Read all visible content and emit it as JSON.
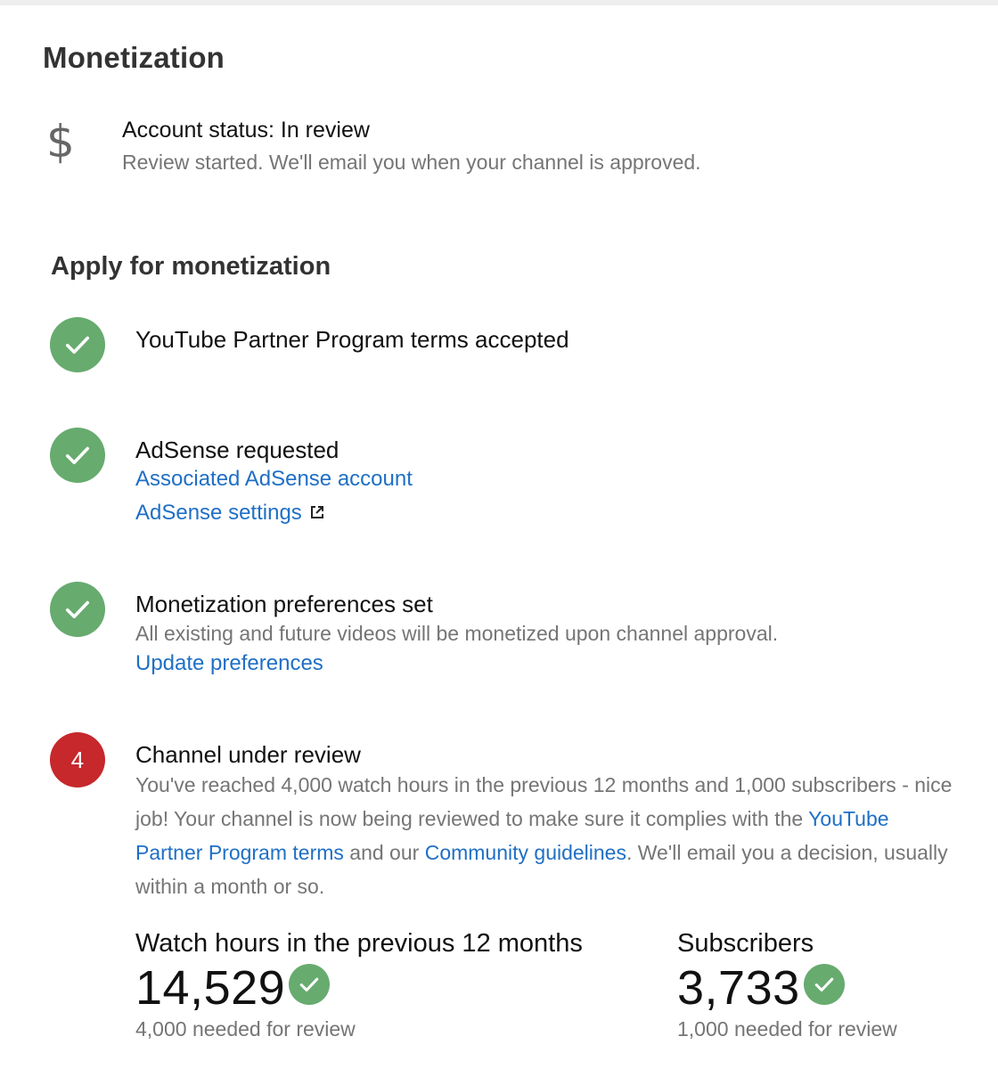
{
  "page_title": "Monetization",
  "account_status": {
    "icon": "dollar-icon",
    "symbol": "$",
    "title": "Account status: In review",
    "subtitle": "Review started. We'll email you when your channel is approved."
  },
  "apply_section": {
    "title": "Apply for monetization",
    "steps": [
      {
        "state": "done",
        "title": "YouTube Partner Program terms accepted"
      },
      {
        "state": "done",
        "title": "AdSense requested",
        "links": [
          "Associated AdSense account",
          "AdSense settings"
        ]
      },
      {
        "state": "done",
        "title": "Monetization preferences set",
        "description": "All existing and future videos will be monetized upon channel approval.",
        "link": "Update preferences"
      },
      {
        "state": "current",
        "number": "4",
        "title": "Channel under review",
        "text_1": "You've reached 4,000 watch hours in the previous 12 months and 1,000 subscribers - nice job! Your channel is now being reviewed to make sure it complies with the ",
        "link_terms": "YouTube Partner Program terms",
        "text_2": " and our ",
        "link_guidelines": "Community guidelines",
        "text_3": ". We'll email you a decision, usually within a month or so."
      }
    ]
  },
  "stats": {
    "watch_hours": {
      "label": "Watch hours in the previous 12 months",
      "value": "14,529",
      "note": "4,000 needed for review"
    },
    "subscribers": {
      "label": "Subscribers",
      "value": "3,733",
      "note": "1,000 needed for review"
    }
  },
  "colors": {
    "success_green": "#67ab6f",
    "step_red": "#c6282c",
    "link_blue": "#1f6fc5",
    "muted_text": "#757575"
  }
}
